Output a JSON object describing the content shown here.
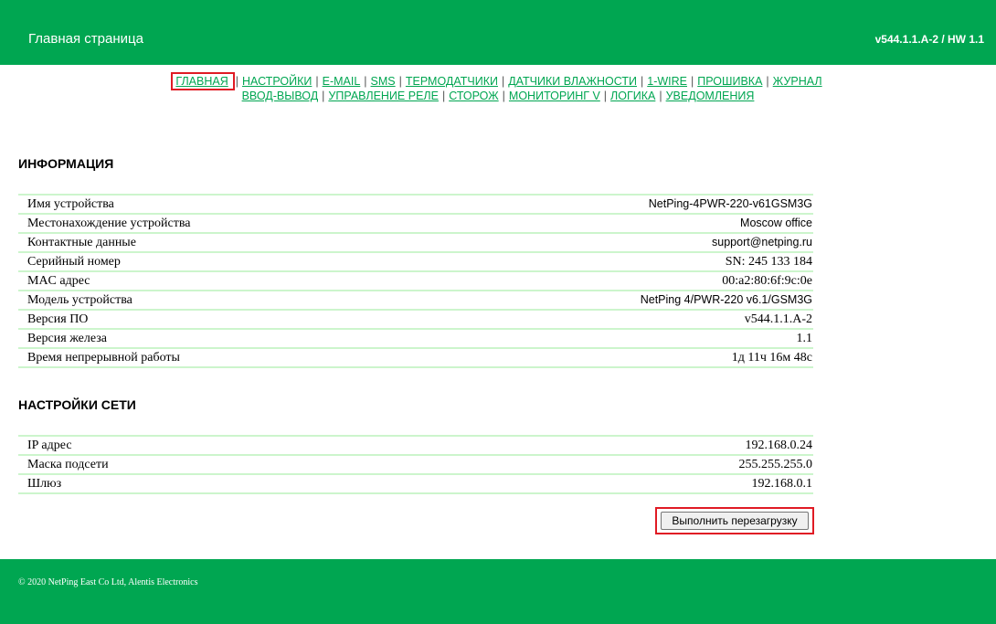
{
  "header": {
    "title": "Главная страница",
    "version": "v544.1.1.A-2 / HW 1.1"
  },
  "nav": {
    "row1": [
      "ГЛАВНАЯ",
      "НАСТРОЙКИ",
      "E-MAIL",
      "SMS",
      "ТЕРМОДАТЧИКИ",
      "ДАТЧИКИ ВЛАЖНОСТИ",
      "1-WIRE",
      "ПРОШИВКА",
      "ЖУРНАЛ"
    ],
    "row2": [
      "ВВОД-ВЫВОД",
      "УПРАВЛЕНИЕ РЕЛЕ",
      "СТОРОЖ",
      "МОНИТОРИНГ V",
      "ЛОГИКА",
      "УВЕДОМЛЕНИЯ"
    ],
    "current": "ГЛАВНАЯ"
  },
  "info": {
    "title": "ИНФОРМАЦИЯ",
    "rows": [
      {
        "label": "Имя устройства",
        "value": "NetPing-4PWR-220-v61GSM3G"
      },
      {
        "label": "Местонахождение устройства",
        "value": "Moscow office"
      },
      {
        "label": "Контактные данные",
        "value": "support@netping.ru"
      },
      {
        "label": "Серийный номер",
        "value": "SN: 245 133 184"
      },
      {
        "label": "MAC адрес",
        "value": "00:a2:80:6f:9c:0e"
      },
      {
        "label": "Модель устройства",
        "value": "NetPing 4/PWR-220 v6.1/GSM3G"
      },
      {
        "label": "Версия ПО",
        "value": "v544.1.1.A-2"
      },
      {
        "label": "Версия железа",
        "value": "1.1"
      },
      {
        "label": "Время непрерывной работы",
        "value": "1д 11ч 16м 48с"
      }
    ]
  },
  "network": {
    "title": "НАСТРОЙКИ СЕТИ",
    "rows": [
      {
        "label": "IP адрес",
        "value": "192.168.0.24"
      },
      {
        "label": "Маска подсети",
        "value": "255.255.255.0"
      },
      {
        "label": "Шлюз",
        "value": "192.168.0.1"
      }
    ]
  },
  "reboot_label": "Выполнить перезагрузку",
  "footer": {
    "copyright": "© 2020 NetPing East Co Ltd, Alentis Electronics"
  },
  "colors": {
    "brand_green": "#00a651",
    "row_border": "#ccf5cc",
    "highlight": "#e01b24"
  }
}
